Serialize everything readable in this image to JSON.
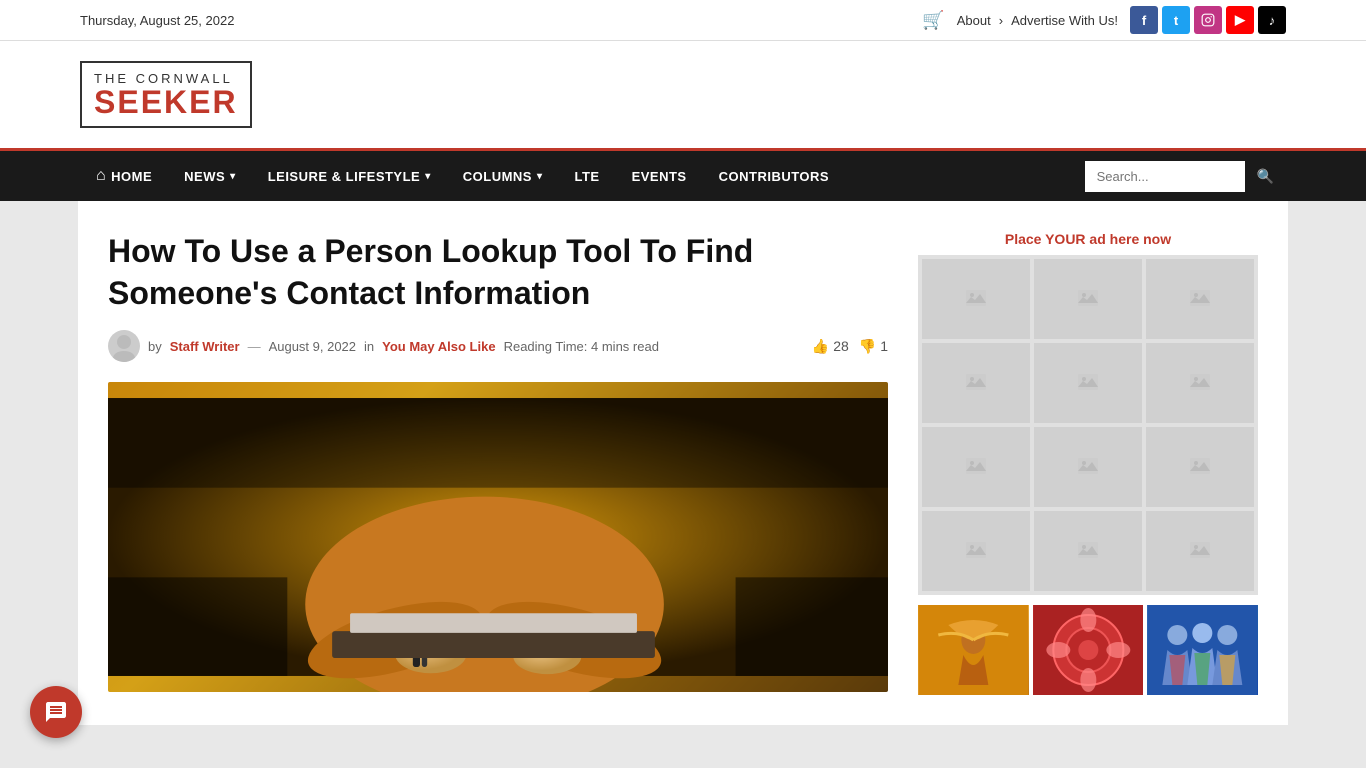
{
  "topbar": {
    "date": "Thursday, August 25, 2022",
    "about_label": "About",
    "advertise_label": "Advertise With Us!",
    "cart_icon": "🛒"
  },
  "social": [
    {
      "name": "facebook",
      "letter": "f",
      "class": "social-fb"
    },
    {
      "name": "twitter",
      "letter": "t",
      "class": "social-tw"
    },
    {
      "name": "instagram",
      "letter": "in",
      "class": "social-ig"
    },
    {
      "name": "youtube",
      "letter": "▶",
      "class": "social-yt"
    },
    {
      "name": "tiktok",
      "letter": "♪",
      "class": "social-tk"
    }
  ],
  "logo": {
    "top": "THE CORNWALL",
    "bottom": "SEEKER"
  },
  "nav": {
    "items": [
      {
        "id": "home",
        "label": "HOME",
        "hasIcon": true,
        "hasDropdown": false
      },
      {
        "id": "news",
        "label": "NEWS",
        "hasIcon": false,
        "hasDropdown": true
      },
      {
        "id": "leisure",
        "label": "LEISURE & LIFESTYLE",
        "hasIcon": false,
        "hasDropdown": true
      },
      {
        "id": "columns",
        "label": "COLUMNS",
        "hasIcon": false,
        "hasDropdown": true
      },
      {
        "id": "lte",
        "label": "LTE",
        "hasIcon": false,
        "hasDropdown": false
      },
      {
        "id": "events",
        "label": "EVENTS",
        "hasIcon": false,
        "hasDropdown": false
      },
      {
        "id": "contributors",
        "label": "CONTRIBUTORS",
        "hasIcon": false,
        "hasDropdown": false
      }
    ],
    "search_placeholder": "Search..."
  },
  "article": {
    "title": "How To Use a Person Lookup Tool To Find Someone's Contact Information",
    "author": "Staff Writer",
    "date": "August 9, 2022",
    "category": "You May Also Like",
    "reading_time": "Reading Time: 4 mins read",
    "likes": "28",
    "dislikes": "1",
    "by_label": "by",
    "in_label": "in"
  },
  "sidebar": {
    "ad_text": "Place YOUR ad here now"
  }
}
